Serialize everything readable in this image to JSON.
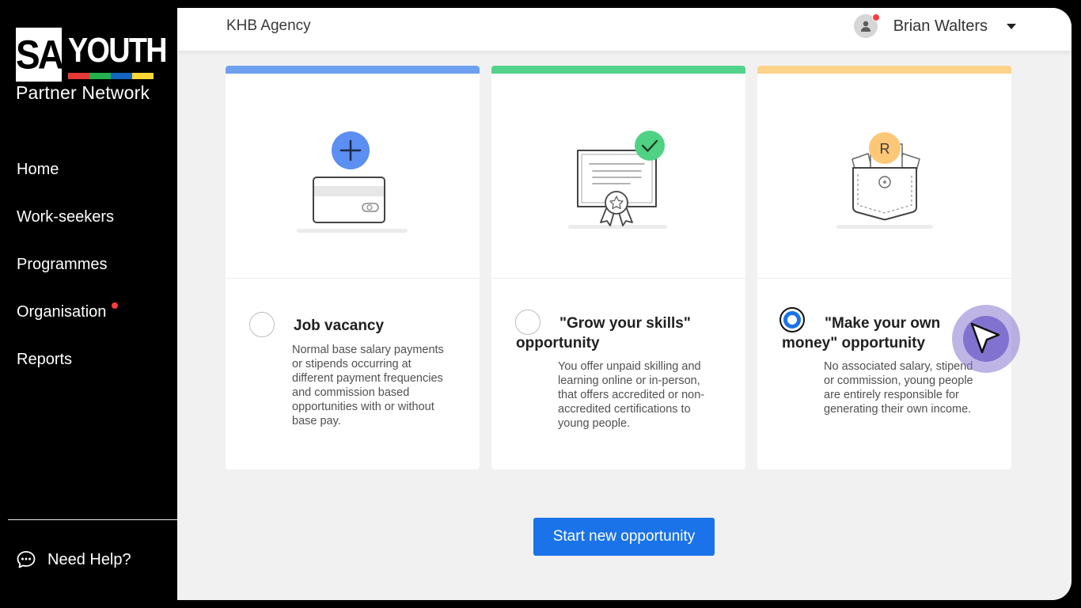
{
  "brand": {
    "logo_left": "SA",
    "logo_right": "YOUTH",
    "tagline": "Partner Network",
    "stripe_colors": [
      "#e53935",
      "#22b14c",
      "#1565c0",
      "#fdd835"
    ]
  },
  "sidebar": {
    "items": [
      {
        "label": "Home",
        "badge": false
      },
      {
        "label": "Work-seekers",
        "badge": false
      },
      {
        "label": "Programmes",
        "badge": false
      },
      {
        "label": "Organisation",
        "badge": true
      },
      {
        "label": "Reports",
        "badge": false
      }
    ],
    "help_label": "Need Help?",
    "help_icon": "chat-bubble-icon"
  },
  "header": {
    "agency": "KHB Agency",
    "user_name": "Brian Walters",
    "avatar_icon": "user-icon",
    "dropdown_icon": "caret-down-icon"
  },
  "cards": [
    {
      "accent": "#6ea0f0",
      "icon": "credit-card-plus-icon",
      "title": "Job vacancy",
      "description_lines": [
        "Normal base salary payments",
        "or stipends occurring at",
        "different payment frequencies",
        "and commission based",
        "opportunities with or without",
        "base pay."
      ],
      "selected": false
    },
    {
      "accent": "#52d38b",
      "icon": "certificate-icon",
      "title_line1": "\"Grow your skills\"",
      "title_line2": "opportunity",
      "description_lines": [
        "You offer unpaid skilling and",
        "learning online or in-person,",
        "that offers accredited or non-",
        "accredited certifications to",
        "young people."
      ],
      "selected": false
    },
    {
      "accent": "#fdd28a",
      "icon": "money-pocket-icon",
      "icon_letter": "R",
      "title_line1": "\"Make your own",
      "title_line2": "money\" opportunity",
      "description_lines": [
        "No associated salary, stipend",
        "or commission, young people",
        "are entirely responsible for",
        "generating their own income."
      ],
      "selected": true
    }
  ],
  "actions": {
    "start_label": "Start new opportunity",
    "accent": "#1a73e8"
  }
}
